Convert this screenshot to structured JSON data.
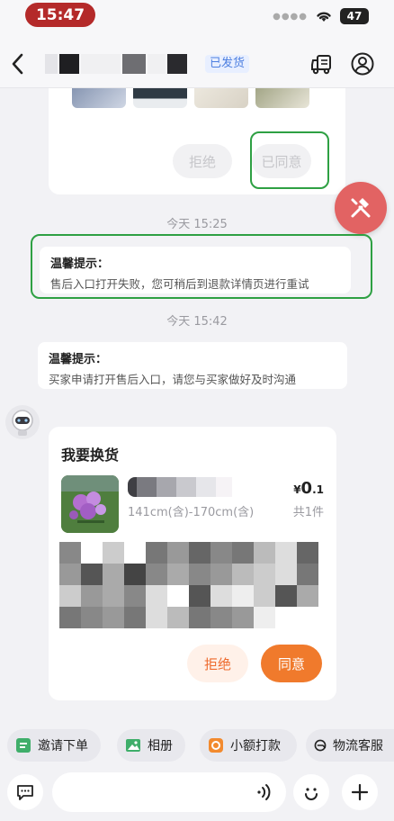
{
  "status_bar": {
    "time": "15:47",
    "battery": "47"
  },
  "header": {
    "status_badge": "已发货"
  },
  "top_card": {
    "reject_label": "拒绝",
    "agreed_label": "已同意"
  },
  "messages": [
    {
      "time": "今天 15:25",
      "tip_title": "温馨提示：",
      "tip_body": "售后入口打开失败，您可稍后到退款详情页进行重试"
    },
    {
      "time": "今天 15:42",
      "tip_title": "温馨提示：",
      "tip_body": "买家申请打开售后入口，请您与买家做好及时沟通"
    }
  ],
  "exchange_card": {
    "title": "我要换货",
    "size": "141cm(含)-170cm(含)",
    "currency": "¥",
    "price_int": "0",
    "price_dec": ".1",
    "quantity": "共1件",
    "reject_label": "拒绝",
    "agree_label": "同意"
  },
  "quick_actions": [
    {
      "label": "邀请下单",
      "icon": "invite-order-icon"
    },
    {
      "label": "相册",
      "icon": "album-icon"
    },
    {
      "label": "小额打款",
      "icon": "small-payment-icon"
    },
    {
      "label": "物流客服",
      "icon": "logistics-service-icon"
    }
  ],
  "colors": {
    "accent": "#f07a2c",
    "highlight_box": "#2ea043",
    "badge": "#4d7fe0"
  }
}
